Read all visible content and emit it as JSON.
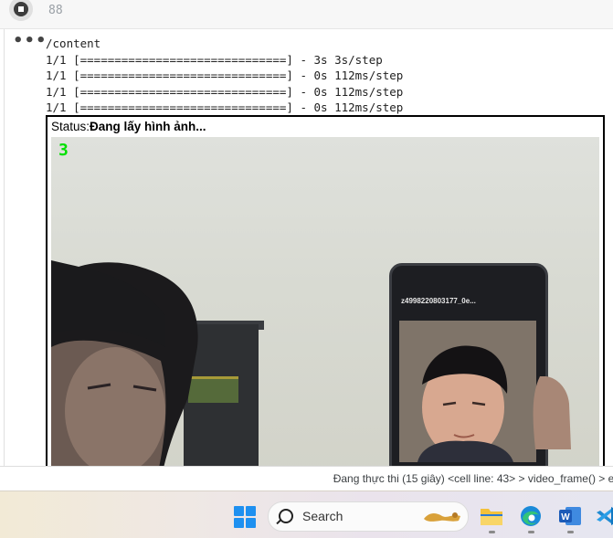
{
  "cell": {
    "execution_count": "88"
  },
  "output": {
    "more_label": "•••",
    "log_lines": [
      "/content",
      "1/1 [==============================] - 3s 3s/step",
      "1/1 [==============================] - 0s 112ms/step",
      "1/1 [==============================] - 0s 112ms/step",
      "1/1 [==============================] - 0s 112ms/step"
    ],
    "status_label": "Status:",
    "status_value": "Đang lấy hình ảnh...",
    "video": {
      "overlay_digit": "3",
      "phone_caption": "z4998220803177_0e..."
    }
  },
  "exec_status": {
    "text": "Đang thực thi (15 giây)",
    "cell_line": "<cell line: 43>",
    "sep1": ">",
    "func1": "video_frame()",
    "sep2": ">",
    "func2": "eva"
  },
  "taskbar": {
    "search_placeholder": "Search",
    "icons": [
      "windows-start-icon",
      "search-icon",
      "file-explorer-icon",
      "edge-browser-icon",
      "word-icon",
      "vscode-icon"
    ]
  }
}
